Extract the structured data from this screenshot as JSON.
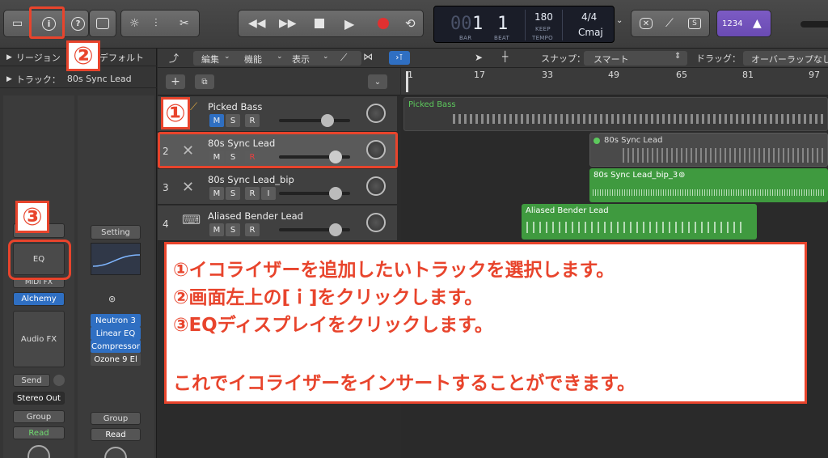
{
  "toolbar": {
    "lcd": {
      "bar": "1",
      "beat": "1",
      "bar_prefix": "00",
      "bar_label": "BAR",
      "beat_label": "BEAT",
      "tempo": "180",
      "keep_label": "KEEP",
      "tempo_label": "TEMPO",
      "signature": "4/4",
      "key": "Cmaj"
    },
    "score_label": "S",
    "count_in": "1234"
  },
  "inspector": {
    "region_label": "リージョン",
    "default_label": "デフォルト",
    "track_prefix": "トラック：",
    "track_name": "80s Sync Lead",
    "strip1": {
      "setting": "Sc...",
      "eq": "EQ",
      "midi_fx": "MIDI FX",
      "instrument": "Alchemy",
      "audio_fx": "Audio FX",
      "send": "Send",
      "output": "Stereo Out",
      "group": "Group",
      "automation": "Read"
    },
    "strip2": {
      "setting": "Setting",
      "plugins": [
        "Neutron 3",
        "Linear EQ",
        "Compressor",
        "Ozone 9 El"
      ],
      "group": "Group",
      "automation": "Read"
    }
  },
  "track_menu": {
    "edit": "編集",
    "function": "機能",
    "view": "表示",
    "snap_label": "スナップ：",
    "snap_value": "スマート",
    "drag_label": "ドラッグ：",
    "drag_value": "オーバーラップなし"
  },
  "ruler": {
    "bars": [
      "1",
      "17",
      "33",
      "49",
      "65",
      "81",
      "97"
    ]
  },
  "tracks": [
    {
      "number": "",
      "name": "Picked Bass",
      "m": "M",
      "s": "S",
      "r": "R",
      "i": ""
    },
    {
      "number": "2",
      "name": "80s Sync Lead",
      "m": "M",
      "s": "S",
      "r": "R",
      "i": ""
    },
    {
      "number": "3",
      "name": "80s Sync Lead_bip",
      "m": "M",
      "s": "S",
      "r": "R",
      "i": "I"
    },
    {
      "number": "4",
      "name": "Aliased Bender Lead",
      "m": "M",
      "s": "S",
      "r": "R",
      "i": ""
    }
  ],
  "regions": [
    {
      "title": "Picked Bass"
    },
    {
      "title": "80s Sync Lead"
    },
    {
      "title": "80s Sync Lead_bip_3"
    },
    {
      "title": "Aliased Bender Lead"
    }
  ],
  "annotations": {
    "badge1": "①",
    "badge2": "②",
    "badge3": "③",
    "lines": [
      "①イコライザーを追加したいトラックを選択します。",
      "②画面左上の[ｉ]をクリックします。",
      "③EQディスプレイをクリックします。",
      "これでイコライザーをインサートすることができます。"
    ]
  },
  "colors": {
    "annotation_red": "#e8442c",
    "region_green": "#3f9a3f",
    "lcd_bg": "#1a1d28"
  }
}
